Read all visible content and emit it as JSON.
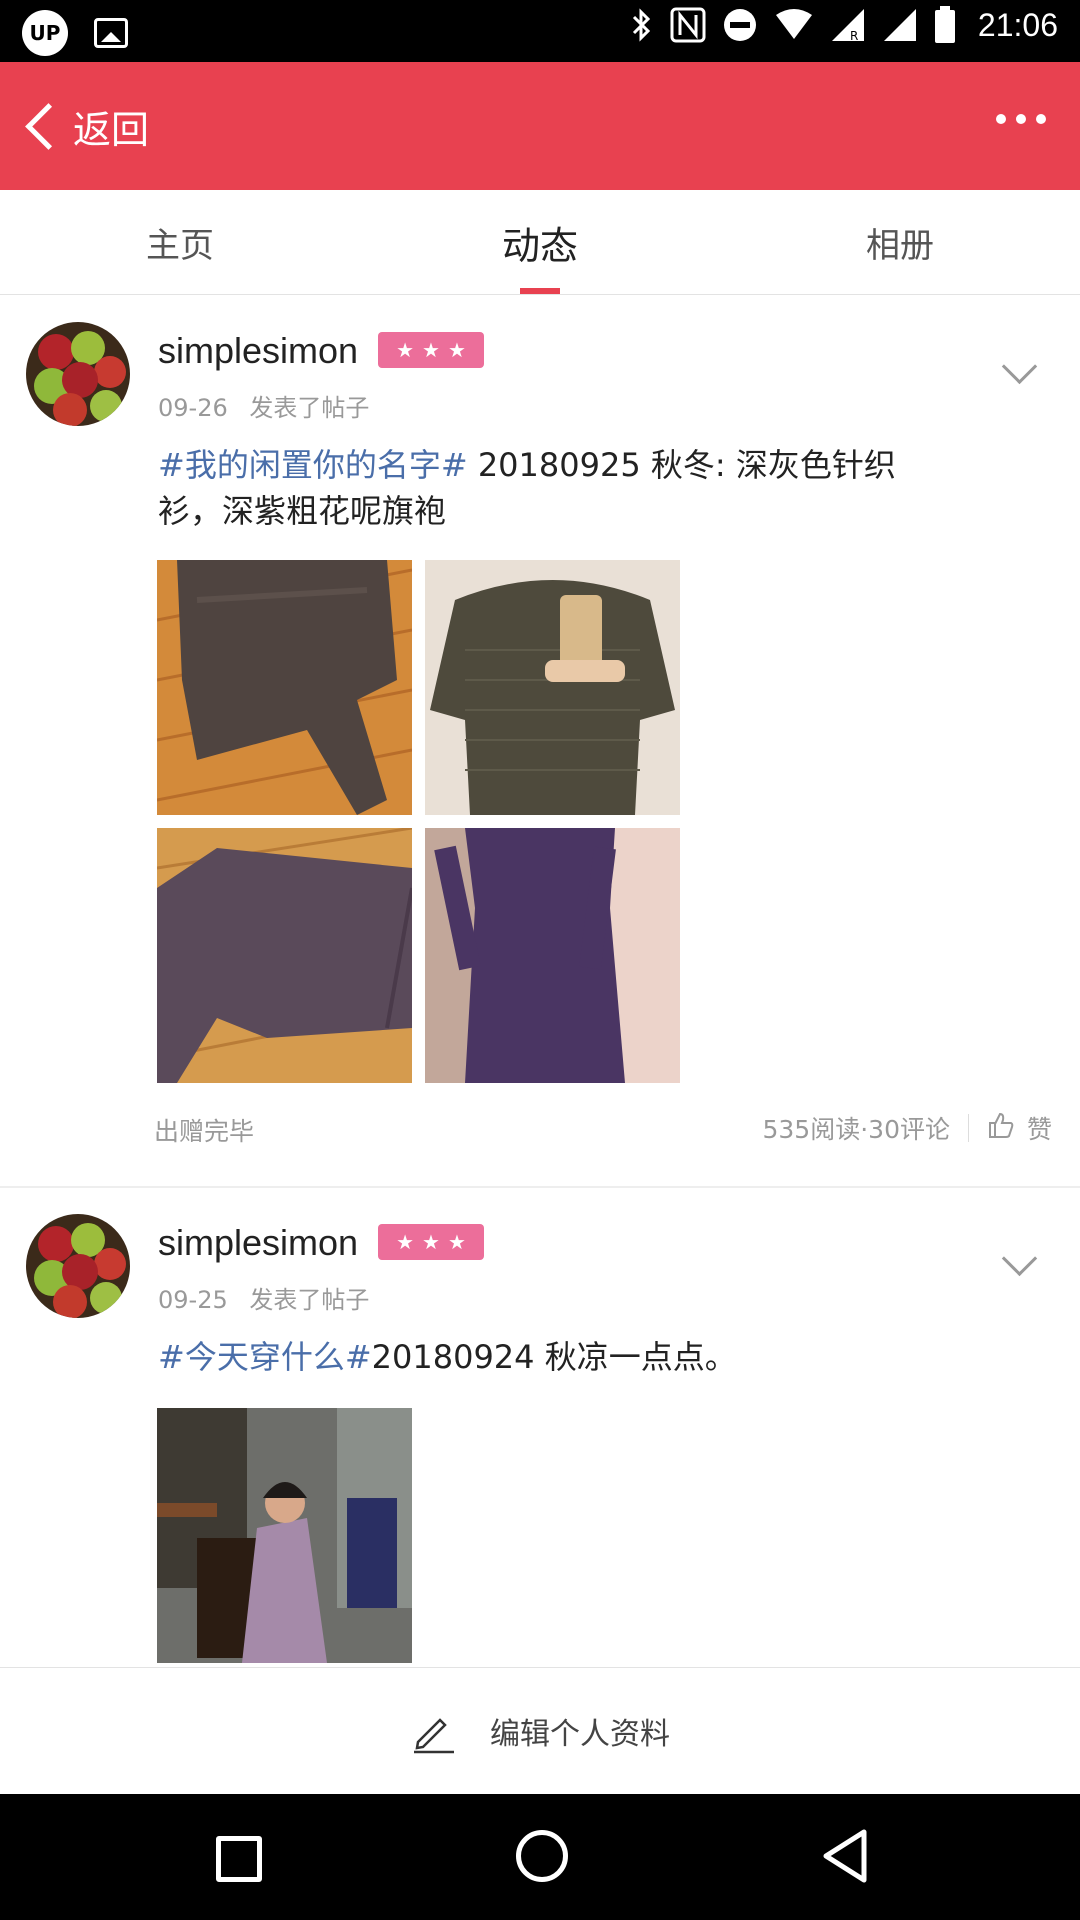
{
  "status_bar": {
    "time": "21:06",
    "app_badge": "UP"
  },
  "header": {
    "back_label": "返回"
  },
  "tabs": [
    {
      "label": "主页",
      "active": false
    },
    {
      "label": "动态",
      "active": true
    },
    {
      "label": "相册",
      "active": false
    }
  ],
  "posts": [
    {
      "username": "simplesimon",
      "date": "09-26",
      "action": "发表了帖子",
      "hashtag": "#我的闲置你的名字#",
      "text_line1": " 20180925 秋冬: 深灰色针织",
      "text_line2": "衫，深紫粗花呢旗袍",
      "status": "出赠完毕",
      "stats": "535阅读·30评论",
      "like_label": "赞"
    },
    {
      "username": "simplesimon",
      "date": "09-25",
      "action": "发表了帖子",
      "hashtag": "#今天穿什么#",
      "text_line1": "20180924 秋凉一点点。"
    }
  ],
  "bottom_action": {
    "label": "编辑个人资料"
  },
  "colors": {
    "accent": "#e84150",
    "tag": "#4a6ea9",
    "badge": "#ec6e9a"
  }
}
